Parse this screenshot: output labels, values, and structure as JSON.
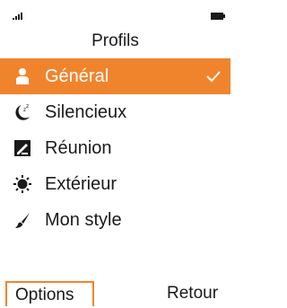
{
  "header": {
    "title": "Profils"
  },
  "profiles": [
    {
      "label": "Général",
      "icon": "user-icon",
      "selected": true
    },
    {
      "label": "Silencieux",
      "icon": "moon-sleep-icon",
      "selected": false
    },
    {
      "label": "Réunion",
      "icon": "meeting-icon",
      "selected": false
    },
    {
      "label": "Extérieur",
      "icon": "sun-icon",
      "selected": false
    },
    {
      "label": "Mon style",
      "icon": "brush-icon",
      "selected": false
    }
  ],
  "softkeys": {
    "left": "Options",
    "right": "Retour"
  },
  "colors": {
    "accent": "#f0842d",
    "text": "#1a1a1a",
    "background": "#ffffff"
  }
}
